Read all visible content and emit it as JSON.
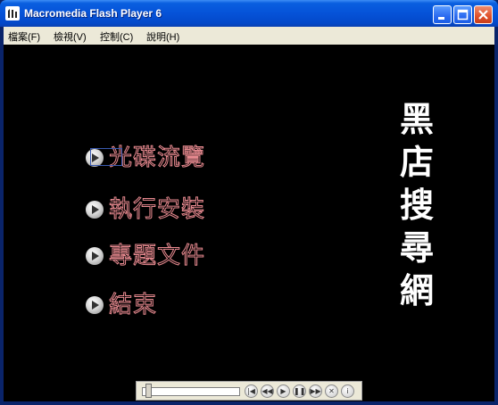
{
  "window": {
    "title": "Macromedia Flash Player 6",
    "controls": {
      "minimize_icon": "minimize-icon",
      "maximize_icon": "maximize-icon",
      "close_icon": "close-icon"
    }
  },
  "menubar": {
    "items": [
      {
        "label": "檔案(F)"
      },
      {
        "label": "檢視(V)"
      },
      {
        "label": "控制(C)"
      },
      {
        "label": "說明(H)"
      }
    ]
  },
  "stage": {
    "menu": [
      {
        "label": "光碟流覽"
      },
      {
        "label": "執行安裝"
      },
      {
        "label": "專題文件"
      },
      {
        "label": "結束"
      }
    ],
    "vertical_title": [
      "黑",
      "店",
      "搜",
      "尋",
      "網"
    ]
  },
  "controller": {
    "buttons": [
      "rewind-icon",
      "step-back-icon",
      "play-icon",
      "pause-icon",
      "step-forward-icon",
      "stop-icon",
      "info-icon"
    ]
  },
  "colors": {
    "titlebar": "#0552d8",
    "menubar": "#ece9d8",
    "stage": "#000000",
    "menu_text": "#e88a90",
    "vertical_title": "#ffffff"
  }
}
